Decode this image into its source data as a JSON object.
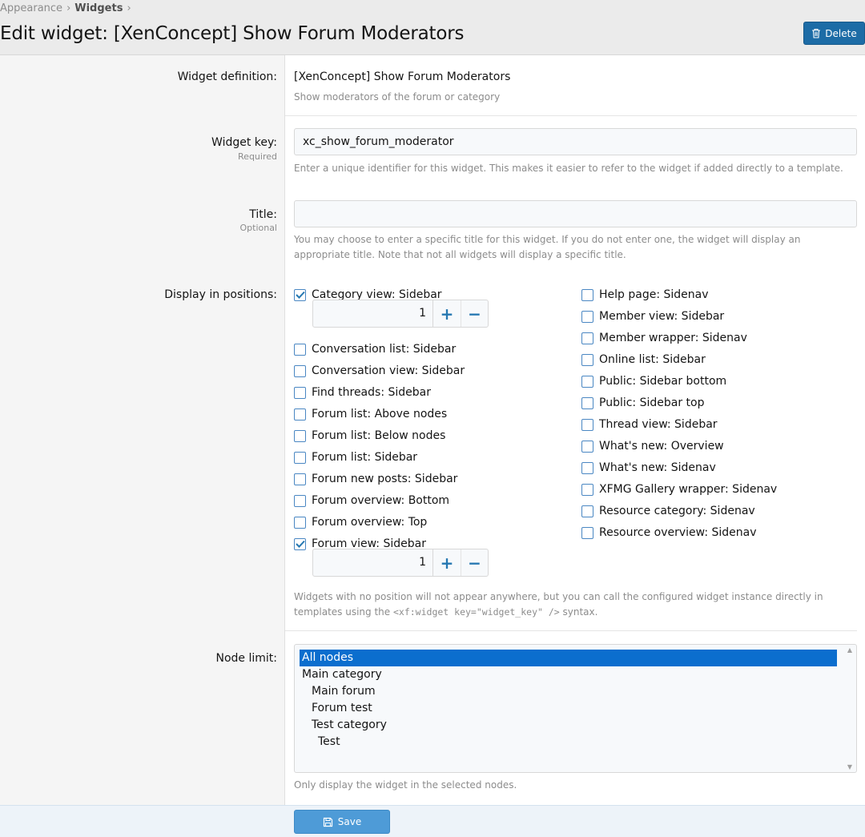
{
  "breadcrumb": [
    "Appearance",
    "Widgets"
  ],
  "page_title": "Edit widget: [XenConcept] Show Forum Moderators",
  "delete_label": "Delete",
  "definition": {
    "label": "Widget definition:",
    "value": "[XenConcept] Show Forum Moderators",
    "description": "Show moderators of the forum or category"
  },
  "widget_key": {
    "label": "Widget key:",
    "hint": "Required",
    "value": "xc_show_forum_moderator",
    "explain": "Enter a unique identifier for this widget. This makes it easier to refer to the widget if added directly to a template."
  },
  "title_field": {
    "label": "Title:",
    "hint": "Optional",
    "value": "",
    "explain": "You may choose to enter a specific title for this widget. If you do not enter one, the widget will display an appropriate title. Note that not all widgets will display a specific title."
  },
  "positions": {
    "label": "Display in positions:",
    "left": [
      {
        "label": "Category view: Sidebar",
        "checked": true,
        "order": "1"
      },
      {
        "label": "Conversation list: Sidebar",
        "checked": false
      },
      {
        "label": "Conversation view: Sidebar",
        "checked": false
      },
      {
        "label": "Find threads: Sidebar",
        "checked": false
      },
      {
        "label": "Forum list: Above nodes",
        "checked": false
      },
      {
        "label": "Forum list: Below nodes",
        "checked": false
      },
      {
        "label": "Forum list: Sidebar",
        "checked": false
      },
      {
        "label": "Forum new posts: Sidebar",
        "checked": false
      },
      {
        "label": "Forum overview: Bottom",
        "checked": false
      },
      {
        "label": "Forum overview: Top",
        "checked": false
      },
      {
        "label": "Forum view: Sidebar",
        "checked": true,
        "order": "1"
      }
    ],
    "right": [
      {
        "label": "Help page: Sidenav",
        "checked": false
      },
      {
        "label": "Member view: Sidebar",
        "checked": false
      },
      {
        "label": "Member wrapper: Sidenav",
        "checked": false
      },
      {
        "label": "Online list: Sidebar",
        "checked": false
      },
      {
        "label": "Public: Sidebar bottom",
        "checked": false
      },
      {
        "label": "Public: Sidebar top",
        "checked": false
      },
      {
        "label": "Thread view: Sidebar",
        "checked": false
      },
      {
        "label": "What's new: Overview",
        "checked": false
      },
      {
        "label": "What's new: Sidenav",
        "checked": false
      },
      {
        "label": "XFMG Gallery wrapper: Sidenav",
        "checked": false
      },
      {
        "label": "Resource category: Sidenav",
        "checked": false
      },
      {
        "label": "Resource overview: Sidenav",
        "checked": false
      }
    ],
    "explain_before": "Widgets with no position will not appear anywhere, but you can call the configured widget instance directly in templates using the ",
    "explain_code": "<xf:widget key=\"widget_key\" />",
    "explain_after": " syntax."
  },
  "node_limit": {
    "label": "Node limit:",
    "options": [
      {
        "label": "All nodes",
        "depth": 0,
        "selected": true
      },
      {
        "label": "Main category",
        "depth": 1,
        "selected": false
      },
      {
        "label": "Main forum",
        "depth": 2,
        "selected": false
      },
      {
        "label": "Forum test",
        "depth": 2,
        "selected": false
      },
      {
        "label": "Test category",
        "depth": 2,
        "selected": false
      },
      {
        "label": "Test",
        "depth": 3,
        "selected": false
      }
    ],
    "explain": "Only display the widget in the selected nodes."
  },
  "save_label": "Save",
  "colors": {
    "accent": "#1d6ca6",
    "selected": "#0b6ece",
    "save": "#4e9bd7"
  }
}
